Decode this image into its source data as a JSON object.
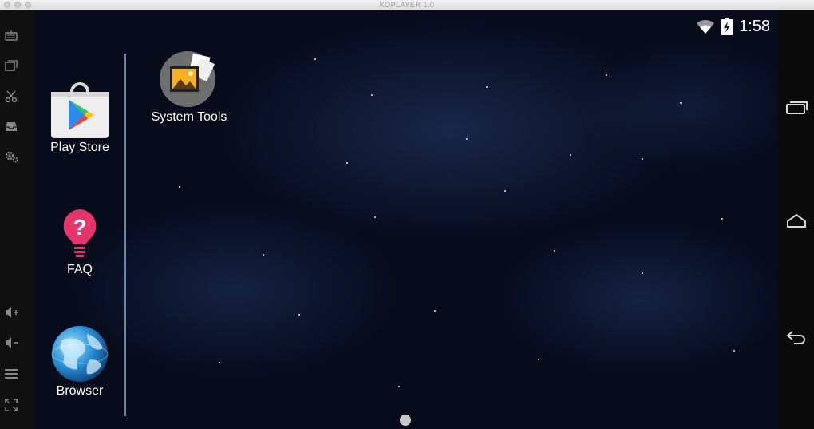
{
  "window": {
    "title": "KOPLAYER 1.0"
  },
  "toolbar": {
    "items": [
      {
        "icon": "keyboard-icon"
      },
      {
        "icon": "multi-window-icon"
      },
      {
        "icon": "scissors-icon"
      },
      {
        "icon": "inbox-icon"
      },
      {
        "icon": "gear-icon"
      },
      {
        "icon": "volume-up-icon"
      },
      {
        "icon": "volume-down-icon"
      },
      {
        "icon": "menu-icon"
      },
      {
        "icon": "fullscreen-icon"
      }
    ]
  },
  "status_bar": {
    "time": "1:58",
    "wifi": "wifi-icon",
    "battery": "battery-charging-icon"
  },
  "dock": {
    "apps": [
      {
        "label": "Play Store",
        "icon": "play-store-icon"
      },
      {
        "label": "FAQ",
        "icon": "faq-icon"
      },
      {
        "label": "Browser",
        "icon": "browser-globe-icon"
      }
    ]
  },
  "desktop": {
    "apps": [
      {
        "label": "System Tools",
        "icon": "system-tools-icon"
      }
    ]
  },
  "nav_bar": {
    "buttons": [
      {
        "icon": "recent-apps-icon"
      },
      {
        "icon": "home-icon"
      },
      {
        "icon": "back-icon"
      }
    ]
  },
  "colors": {
    "accent_divider": "#6a88a8",
    "faq_pink": "#e5356b",
    "wallpaper": "#070c1c"
  }
}
